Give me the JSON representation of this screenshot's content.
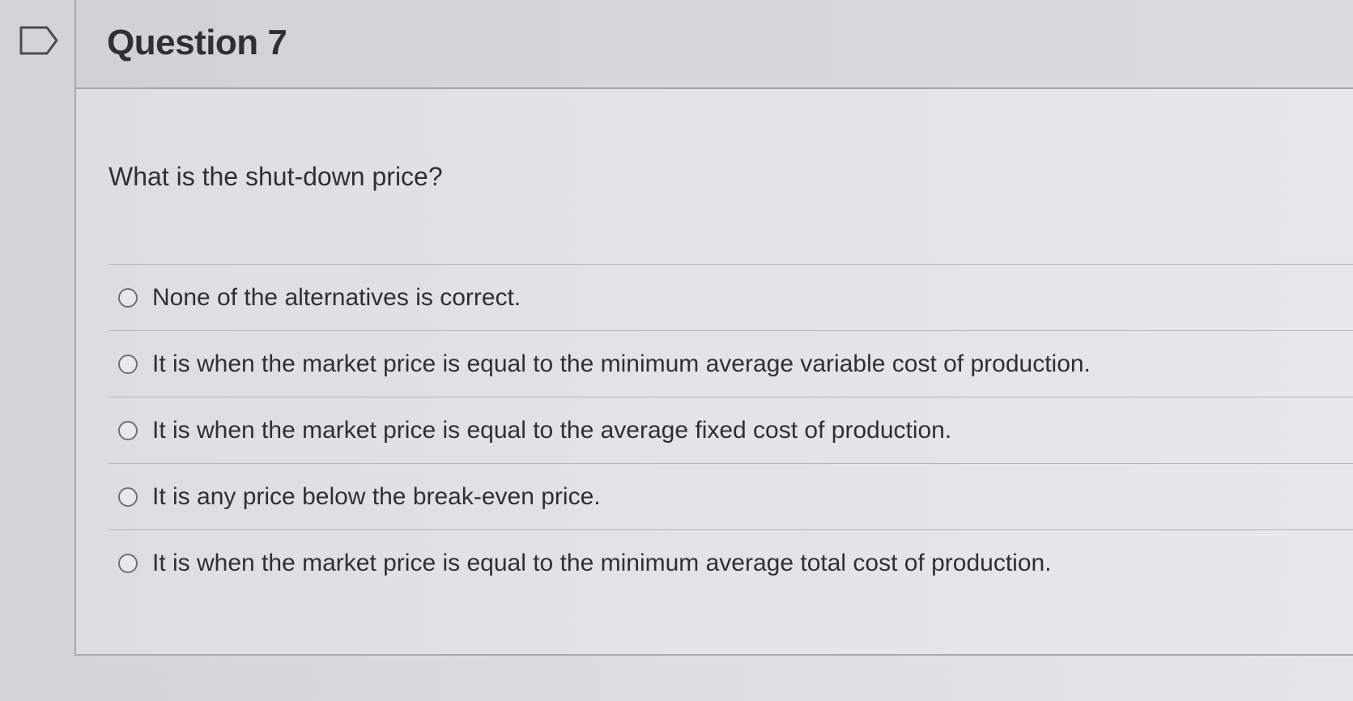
{
  "question": {
    "title": "Question 7",
    "text": "What is the shut-down price?"
  },
  "answers": [
    {
      "label": "None of the alternatives is correct.",
      "selected": false
    },
    {
      "label": "It is when the market price is equal to the minimum average variable cost of production.",
      "selected": false
    },
    {
      "label": "It is when the market price is equal to the average fixed cost of production.",
      "selected": false
    },
    {
      "label": "It is any price below the break-even price.",
      "selected": false
    },
    {
      "label": "It is when the market price is equal to the minimum average total cost of production.",
      "selected": false
    }
  ],
  "icons": {
    "flag": "flag-question-icon"
  }
}
